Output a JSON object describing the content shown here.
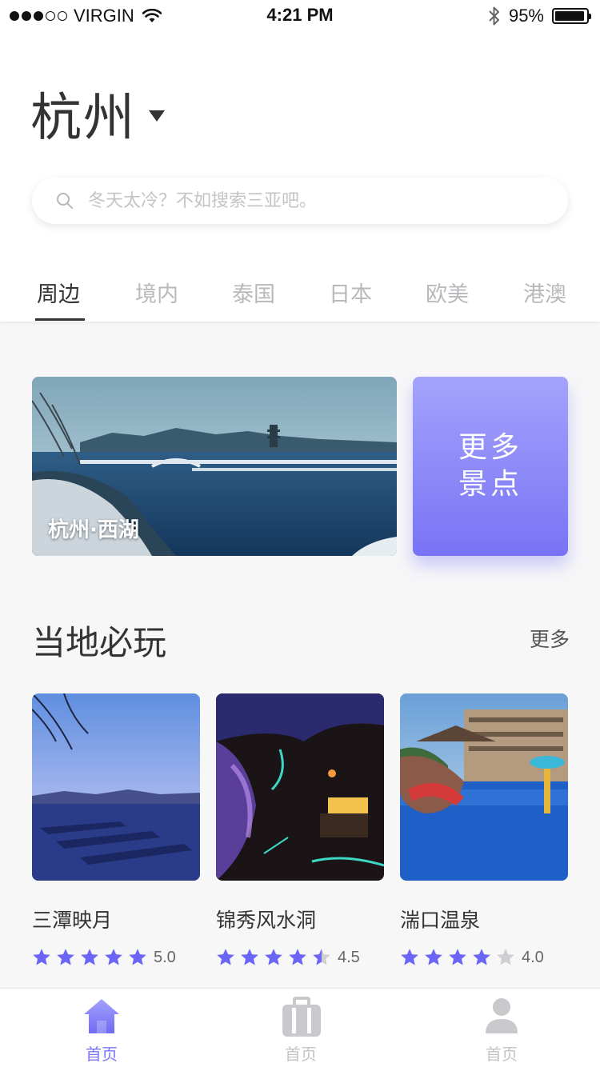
{
  "status_bar": {
    "carrier": "VIRGIN",
    "signal_dots_filled": 3,
    "signal_dots_total": 5,
    "time": "4:21 PM",
    "battery_percent": "95%",
    "battery_level": 0.95
  },
  "header": {
    "city": "杭州"
  },
  "search": {
    "placeholder": "冬天太冷？不如搜索三亚吧。"
  },
  "tabs": [
    {
      "label": "周边",
      "active": true
    },
    {
      "label": "境内",
      "active": false
    },
    {
      "label": "泰国",
      "active": false
    },
    {
      "label": "日本",
      "active": false
    },
    {
      "label": "欧美",
      "active": false
    },
    {
      "label": "港澳",
      "active": false
    }
  ],
  "banner": {
    "caption": "杭州·西湖",
    "more_line1": "更多",
    "more_line2": "景点"
  },
  "section": {
    "title": "当地必玩",
    "more": "更多"
  },
  "cards": [
    {
      "name": "三潭映月",
      "rating": 5.0,
      "rating_text": "5.0"
    },
    {
      "name": "锦秀风水洞",
      "rating": 4.5,
      "rating_text": "4.5"
    },
    {
      "name": "湍口温泉",
      "rating": 4.0,
      "rating_text": "4.0"
    }
  ],
  "bottom_nav": [
    {
      "label": "首页",
      "icon": "home-icon",
      "active": true
    },
    {
      "label": "首页",
      "icon": "luggage-icon",
      "active": false
    },
    {
      "label": "首页",
      "icon": "user-icon",
      "active": false
    }
  ],
  "colors": {
    "accent": "#7a76f6",
    "star": "#6b66f5",
    "star_empty": "#cfcfd3",
    "text_primary": "#333333",
    "text_muted": "#b9b9bd"
  }
}
